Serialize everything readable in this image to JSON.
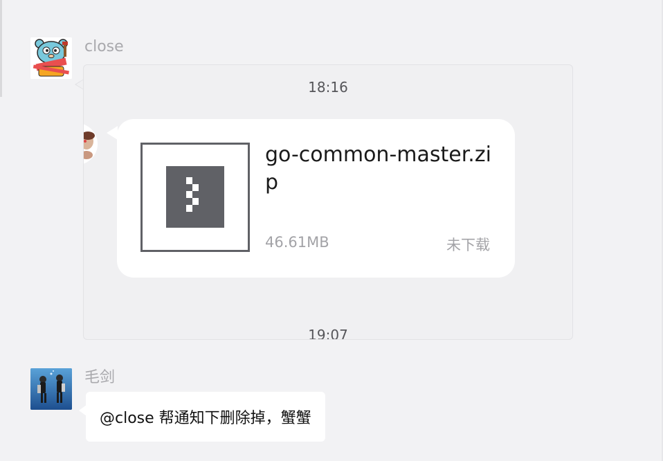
{
  "messages": [
    {
      "sender": "close",
      "type": "chat-record",
      "record": {
        "timestamps": [
          "18:16",
          "19:07"
        ],
        "file": {
          "name": "go-common-master.zip",
          "size": "46.61MB",
          "status": "未下载"
        }
      }
    },
    {
      "sender": "毛剑",
      "type": "text",
      "text": "@close 帮通知下删除掉，蟹蟹"
    }
  ],
  "colors": {
    "background": "#f2f2f4",
    "bubble": "#ffffff",
    "secondary_text": "#a3a3a7",
    "zip_icon": "#606166"
  },
  "icons": {
    "zip": "zip-archive-icon",
    "avatar_close": "gopher-avatar",
    "avatar_maojian": "divers-photo-avatar"
  }
}
